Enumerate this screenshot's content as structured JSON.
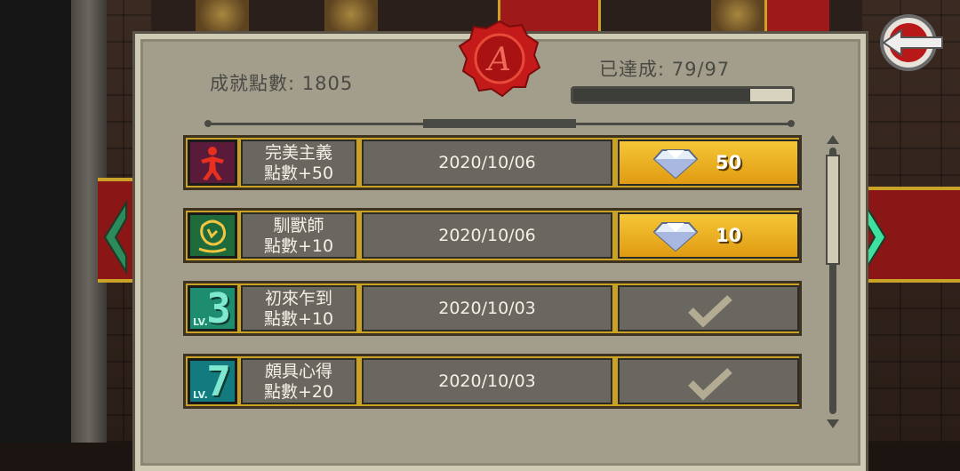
{
  "header": {
    "points_label": "成就點數: 1805",
    "achieved_label": "已達成: 79/97",
    "progress_fraction": 0.81
  },
  "colors": {
    "gold_reward": "#f5c637",
    "row_border": "#c9a123",
    "panel_bg": "#a39e8b",
    "seal_red": "#c41a1a"
  },
  "icons": {
    "seal": "wax-seal-A",
    "back": "back-arrow",
    "nav_left": "chevron-left",
    "nav_right": "chevron-right",
    "diamond": "diamond",
    "check": "checkmark"
  },
  "achievements": [
    {
      "title": "完美主義",
      "points": "點數+50",
      "date": "2020/10/06",
      "reward": "50",
      "claimed": false,
      "badge": "perfectionist-icon"
    },
    {
      "title": "馴獸師",
      "points": "點數+10",
      "date": "2020/10/06",
      "reward": "10",
      "claimed": false,
      "badge": "beast-tamer-icon"
    },
    {
      "title": "初來乍到",
      "points": "點數+10",
      "date": "2020/10/03",
      "reward": "",
      "claimed": true,
      "badge": "level-badge",
      "level": "3",
      "level_label": "LV."
    },
    {
      "title": "頗具心得",
      "points": "點數+20",
      "date": "2020/10/03",
      "reward": "",
      "claimed": true,
      "badge": "level-badge",
      "level": "7",
      "level_label": "LV."
    }
  ]
}
